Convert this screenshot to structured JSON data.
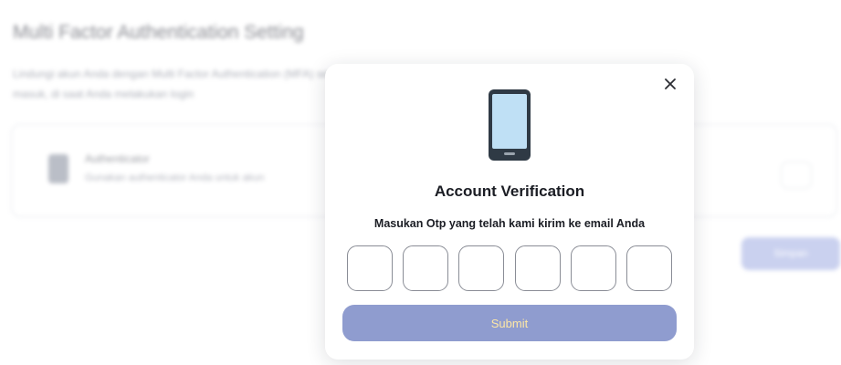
{
  "background": {
    "page_title": "Multi Factor Authentication Setting",
    "description": "Lindungi akun Anda dengan Multi Factor Authentication (MFA) setiap kali Anda masuk, di saat Anda melakukan login",
    "card": {
      "title": "Authenticator",
      "subtitle": "Gunakan authenticator Anda untuk akun"
    },
    "action_button": "Simpan"
  },
  "modal": {
    "title": "Account Verification",
    "subtitle": "Masukan Otp yang telah kami kirim ke email Anda",
    "otp_digits": [
      "",
      "",
      "",
      "",
      "",
      ""
    ],
    "submit_label": "Submit",
    "icons": {
      "phone": "mobile-phone-icon",
      "close": "close-icon"
    },
    "colors": {
      "submit_bg": "#8f9ccf",
      "submit_text": "#fde7a6",
      "phone_frame": "#2f3a45",
      "phone_screen": "#bfe0f5"
    }
  }
}
